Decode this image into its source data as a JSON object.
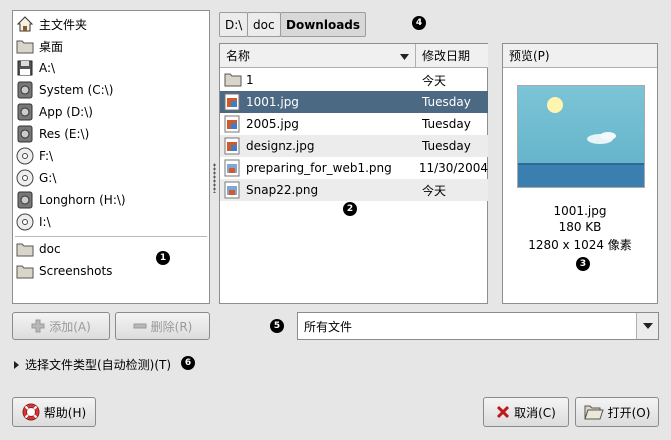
{
  "places": [
    {
      "label": "主文件夹",
      "icon": "home-icon"
    },
    {
      "label": "桌面",
      "icon": "folder-icon"
    },
    {
      "label": "A:\\",
      "icon": "floppy-icon"
    },
    {
      "label": "System (C:\\)",
      "icon": "drive-icon"
    },
    {
      "label": "App (D:\\)",
      "icon": "drive-icon"
    },
    {
      "label": "Res (E:\\)",
      "icon": "drive-icon"
    },
    {
      "label": "F:\\",
      "icon": "cdrom-icon"
    },
    {
      "label": "G:\\",
      "icon": "cdrom-icon"
    },
    {
      "label": "Longhorn (H:\\)",
      "icon": "drive-icon"
    },
    {
      "label": "I:\\",
      "icon": "cdrom-icon"
    }
  ],
  "bookmarks": [
    {
      "label": "doc",
      "icon": "folder-icon"
    },
    {
      "label": "Screenshots",
      "icon": "folder-icon"
    }
  ],
  "pathbar": {
    "segments": [
      "D:\\",
      "doc",
      "Downloads"
    ],
    "active": "Downloads"
  },
  "filelist": {
    "name_header": "名称",
    "date_header": "修改日期",
    "rows": [
      {
        "name": "1",
        "date": "今天",
        "type": "folder"
      },
      {
        "name": "1001.jpg",
        "date": "Tuesday",
        "type": "image",
        "selected": true
      },
      {
        "name": "2005.jpg",
        "date": "Tuesday",
        "type": "image"
      },
      {
        "name": "designz.jpg",
        "date": "Tuesday",
        "type": "image"
      },
      {
        "name": "preparing_for_web1.png",
        "date": "11/30/2004",
        "type": "image"
      },
      {
        "name": "Snap22.png",
        "date": "今天",
        "type": "image"
      }
    ]
  },
  "preview": {
    "header": "预览(P)",
    "filename": "1001.jpg",
    "size": "180 KB",
    "dimensions": "1280 x 1024 像素"
  },
  "buttons": {
    "add": "添加(A)",
    "remove": "删除(R)",
    "help": "帮助(H)",
    "cancel": "取消(C)",
    "open": "打开(O)"
  },
  "filter": {
    "selected": "所有文件"
  },
  "expander": {
    "label": "选择文件类型(自动检测)(T)"
  },
  "callouts": [
    "1",
    "2",
    "3",
    "4",
    "5",
    "6"
  ],
  "colors": {
    "selection": "#4b6983",
    "background": "#e6e6e6"
  }
}
